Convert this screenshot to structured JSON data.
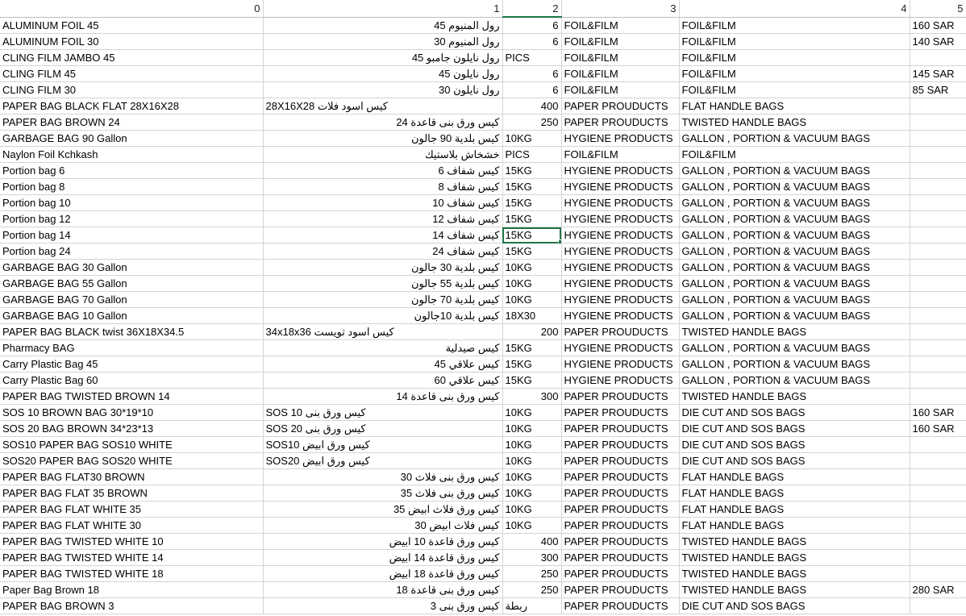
{
  "headers": [
    "0",
    "1",
    "2",
    "3",
    "4",
    "5"
  ],
  "rows": [
    [
      "ALUMINUM FOIL 45",
      "رول المنيوم 45",
      "6",
      "FOIL&FILM",
      "FOIL&FILM",
      "160 SAR"
    ],
    [
      " ALUMINUM FOIL 30",
      "رول المنيوم 30",
      "6",
      "FOIL&FILM",
      "FOIL&FILM",
      "140 SAR"
    ],
    [
      " CLING FILM JAMBO 45",
      "رول نايلون جامبو 45",
      "PICS",
      "FOIL&FILM",
      "FOIL&FILM",
      ""
    ],
    [
      " CLING FILM 45",
      "رول نايلون 45",
      "6",
      "FOIL&FILM",
      "FOIL&FILM",
      "145 SAR"
    ],
    [
      " CLING FILM 30",
      "رول نايلون 30",
      "6",
      "FOIL&FILM",
      "FOIL&FILM",
      "85 SAR"
    ],
    [
      " PAPER BAG BLACK FLAT 28X16X28",
      "كيس اسود فلات 28X16X28",
      "400",
      "PAPER PROUDUCTS",
      "FLAT HANDLE BAGS",
      ""
    ],
    [
      " PAPER BAG BROWN 24",
      "كيس ورق بنى قاعدة 24",
      "250",
      "PAPER PROUDUCTS",
      "TWISTED HANDLE BAGS",
      ""
    ],
    [
      " GARBAGE BAG 90 Gallon",
      "كيس بلدية 90 جالون",
      "10KG",
      "HYGIENE PRODUCTS",
      "GALLON , PORTION & VACUUM BAGS",
      ""
    ],
    [
      " Naylon Foil Kchkash",
      "خشخاش بلاستيك",
      "PICS",
      "FOIL&FILM",
      "FOIL&FILM",
      ""
    ],
    [
      " Portion bag 6",
      "كيس شفاف 6",
      "15KG",
      "HYGIENE PRODUCTS",
      "GALLON , PORTION & VACUUM BAGS",
      ""
    ],
    [
      " Portion bag 8",
      "كيس شفاف 8",
      "15KG",
      "HYGIENE PRODUCTS",
      "GALLON , PORTION & VACUUM BAGS",
      ""
    ],
    [
      " Portion bag 10",
      "كيس شفاف 10",
      "15KG",
      "HYGIENE PRODUCTS",
      "GALLON , PORTION & VACUUM BAGS",
      ""
    ],
    [
      " Portion bag 12",
      "كيس شفاف 12",
      "15KG",
      "HYGIENE PRODUCTS",
      "GALLON , PORTION & VACUUM BAGS",
      ""
    ],
    [
      " Portion bag 14",
      "كيس شفاف 14",
      "15KG",
      "HYGIENE PRODUCTS",
      "GALLON , PORTION & VACUUM BAGS",
      ""
    ],
    [
      " Portion bag 24",
      "كيس شفاف 24",
      "15KG",
      "HYGIENE PRODUCTS",
      "GALLON , PORTION & VACUUM BAGS",
      ""
    ],
    [
      " GARBAGE BAG 30 Gallon",
      "كيس بلدية 30 جالون",
      "10KG",
      "HYGIENE PRODUCTS",
      "GALLON , PORTION & VACUUM BAGS",
      ""
    ],
    [
      " GARBAGE BAG 55 Gallon",
      "كيس بلدية 55 جالون",
      "10KG",
      "HYGIENE PRODUCTS",
      "GALLON , PORTION & VACUUM BAGS",
      ""
    ],
    [
      " GARBAGE BAG 70 Gallon",
      "كيس بلدية 70 جالون",
      "10KG",
      "HYGIENE PRODUCTS",
      "GALLON , PORTION & VACUUM BAGS",
      ""
    ],
    [
      " GARBAGE BAG 10 Gallon",
      "كيس بلدية 10جالون",
      "18X30",
      "HYGIENE PRODUCTS",
      "GALLON , PORTION & VACUUM BAGS",
      ""
    ],
    [
      " PAPER BAG BLACK twist 36X18X34.5",
      "كيس اسود تويست 34x18x36",
      "200",
      "PAPER PROUDUCTS",
      "TWISTED HANDLE BAGS",
      ""
    ],
    [
      " Pharmacy BAG",
      "كيس صيدلية",
      "15KG",
      "HYGIENE PRODUCTS",
      "GALLON , PORTION & VACUUM BAGS",
      ""
    ],
    [
      " Carry Plastic Bag 45",
      "كيس علاقي 45",
      "15KG",
      "HYGIENE PRODUCTS",
      "GALLON , PORTION & VACUUM BAGS",
      ""
    ],
    [
      " Carry Plastic Bag 60",
      "كيس علاقي 60",
      "15KG",
      "HYGIENE PRODUCTS",
      "GALLON , PORTION & VACUUM BAGS",
      ""
    ],
    [
      " PAPER BAG TWISTED BROWN 14",
      "كيس ورق بنى قاعدة 14",
      "300",
      "PAPER PROUDUCTS",
      "TWISTED HANDLE BAGS",
      ""
    ],
    [
      "SOS 10   BROWN BAG 30*19*10",
      "كيس ورق بنى SOS 10",
      "10KG",
      "PAPER PROUDUCTS",
      "DIE CUT AND SOS BAGS",
      "160 SAR"
    ],
    [
      "SOS 20  BAG BROWN 34*23*13",
      "كيس ورق بنى SOS 20",
      "10KG",
      "PAPER PROUDUCTS",
      "DIE CUT AND SOS BAGS",
      "160 SAR"
    ],
    [
      "SOS10  PAPER BAG SOS10 WHITE",
      "كيس ورق ابيض SOS10",
      "10KG",
      "PAPER PROUDUCTS",
      "DIE CUT AND SOS BAGS",
      ""
    ],
    [
      "SOS20 PAPER BAG SOS20 WHITE",
      "كيس ورق ابيض SOS20",
      "10KG",
      "PAPER PROUDUCTS",
      "DIE CUT AND SOS BAGS",
      ""
    ],
    [
      " PAPER BAG FLAT30 BROWN",
      "كيس ورق بنى فلاث 30",
      "10KG",
      "PAPER PROUDUCTS",
      "FLAT HANDLE BAGS",
      ""
    ],
    [
      " PAPER BAG FLAT 35 BROWN",
      "كيس ورق بنى فلاث 35",
      "10KG",
      "PAPER PROUDUCTS",
      "FLAT HANDLE BAGS",
      ""
    ],
    [
      " PAPER BAG FLAT WHITE 35",
      "كيس ورق فلاث ابيض 35",
      "10KG",
      "PAPER PROUDUCTS",
      "FLAT HANDLE BAGS",
      ""
    ],
    [
      " PAPER BAG FLAT WHITE 30",
      "كيس فلاث ابيض 30",
      "10KG",
      "PAPER PROUDUCTS",
      "FLAT HANDLE BAGS",
      ""
    ],
    [
      " PAPER BAG TWISTED WHITE 10",
      "كيس ورق قاعدة 10 ابيض",
      "400",
      "PAPER PROUDUCTS",
      "TWISTED HANDLE BAGS",
      ""
    ],
    [
      " PAPER BAG TWISTED WHITE 14",
      "كيس ورق قاعدة 14 ابيض",
      "300",
      "PAPER PROUDUCTS",
      "TWISTED HANDLE BAGS",
      ""
    ],
    [
      " PAPER BAG TWISTED WHITE 18",
      "كيس ورق قاعدة 18 ابيض",
      "250",
      "PAPER PROUDUCTS",
      "TWISTED HANDLE BAGS",
      ""
    ],
    [
      " Paper Bag Brown 18",
      "كيس ورق بنى قاعدة 18",
      "250",
      "PAPER PROUDUCTS",
      "TWISTED HANDLE BAGS",
      "280 SAR"
    ],
    [
      " PAPER BAG BROWN 3",
      "كيس ورق بنى 3",
      "ربطة",
      "PAPER PROUDUCTS",
      "DIE CUT AND SOS BAGS",
      ""
    ]
  ],
  "left_aligned_col1_rows": [
    5,
    19,
    24,
    25,
    26,
    27
  ],
  "selected_cell": {
    "row": 13,
    "col": 2
  }
}
